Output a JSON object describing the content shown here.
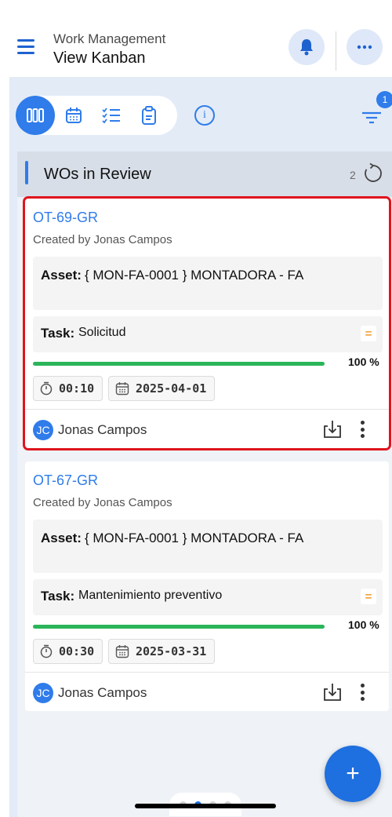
{
  "header": {
    "subtitle": "Work Management",
    "title": "View Kanban"
  },
  "toolbar": {
    "views": [
      "kanban-view",
      "calendar-view",
      "checklist-view",
      "clipboard-view"
    ],
    "info_icon": "i",
    "filter_badge": "1"
  },
  "column": {
    "title": "WOs in Review",
    "count": "2"
  },
  "labels": {
    "asset": "Asset:",
    "task": "Task:",
    "priority": "="
  },
  "cards": [
    {
      "id": "OT-69-GR",
      "created_by": "Created by Jonas Campos",
      "asset": "{ MON-FA-0001 } MONTADORA - FA",
      "task": "Solicitud",
      "progress": 100,
      "progress_label": "100 %",
      "duration": "00:10",
      "date": "2025-04-01",
      "user_initials": "JC",
      "user_name": "Jonas Campos",
      "selected": true
    },
    {
      "id": "OT-67-GR",
      "created_by": "Created by Jonas Campos",
      "asset": "{ MON-FA-0001 } MONTADORA - FA",
      "task": "Mantenimiento preventivo",
      "progress": 100,
      "progress_label": "100 %",
      "duration": "00:30",
      "date": "2025-03-31",
      "user_initials": "JC",
      "user_name": "Jonas Campos",
      "selected": false
    }
  ],
  "fab_label": "+",
  "pager": {
    "pages": 4,
    "current": 2
  },
  "colors": {
    "accent": "#2f7cea",
    "progress": "#2bb55a",
    "priority": "#f2a13a",
    "selection": "#e0141e"
  }
}
